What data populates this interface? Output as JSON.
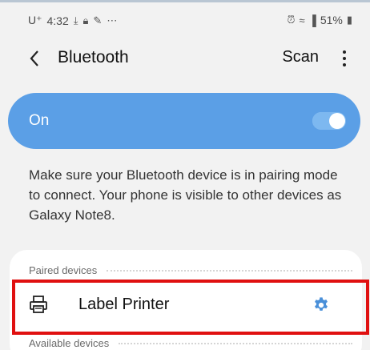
{
  "status_bar": {
    "carrier": "U⁺",
    "time": "4:32",
    "left_icons": [
      "download-icon",
      "lock-icon",
      "edit-icon",
      "more-dots-icon"
    ],
    "right_icons": [
      "alarm-icon",
      "wifi-icon",
      "signal-icon"
    ],
    "battery": "51%"
  },
  "app_bar": {
    "title": "Bluetooth",
    "scan_label": "Scan"
  },
  "toggle_bar": {
    "label": "On",
    "enabled": true,
    "color": "#5b9fe6"
  },
  "description": "Make sure your Bluetooth device is in pairing mode to connect. Your phone is visible to other devices as Galaxy Note8.",
  "paired": {
    "header": "Paired devices",
    "devices": [
      {
        "name": "Label Printer",
        "icon": "printer-icon",
        "settings_icon": "gear-icon"
      }
    ]
  },
  "available": {
    "header": "Available devices"
  },
  "highlight_color": "#e01010"
}
